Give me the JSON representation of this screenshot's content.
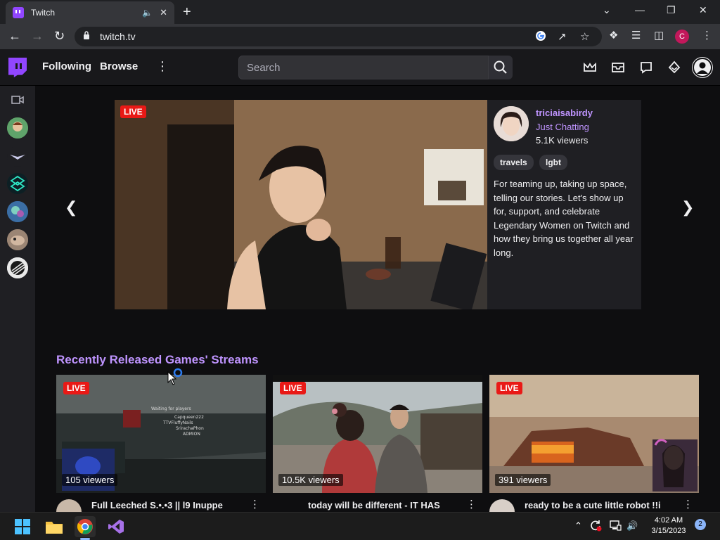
{
  "browser": {
    "tab_title": "Twitch",
    "url": "twitch.tv",
    "profile_initial": "C"
  },
  "nav": {
    "following": "Following",
    "browse": "Browse",
    "search_placeholder": "Search"
  },
  "colors": {
    "twitch_purple": "#9146ff",
    "link_purple": "#bf94ff",
    "live_red": "#e91916"
  },
  "hero": {
    "live_label": "LIVE",
    "streamer": "triciaisabirdy",
    "category": "Just Chatting",
    "viewers": "5.1K viewers",
    "tags": [
      "travels",
      "lgbt"
    ],
    "description": "For teaming up, taking up space, telling our stories. Let's show up for, support, and celebrate Legendary Women on Twitch and how they bring us together all year long."
  },
  "section": {
    "title": "Recently Released Games' Streams"
  },
  "cards": [
    {
      "live": "LIVE",
      "viewers": "105 viewers",
      "title": "Full Leeched S.•.•3 || l9 Inuppe"
    },
    {
      "live": "LIVE",
      "viewers": "10.5K viewers",
      "title": "today will be different - IT HAS"
    },
    {
      "live": "LIVE",
      "viewers": "391 viewers",
      "title": "ready to be a cute little robot !!i"
    }
  ],
  "taskbar": {
    "time": "4:02 AM",
    "date": "3/15/2023",
    "notifications": "2"
  }
}
